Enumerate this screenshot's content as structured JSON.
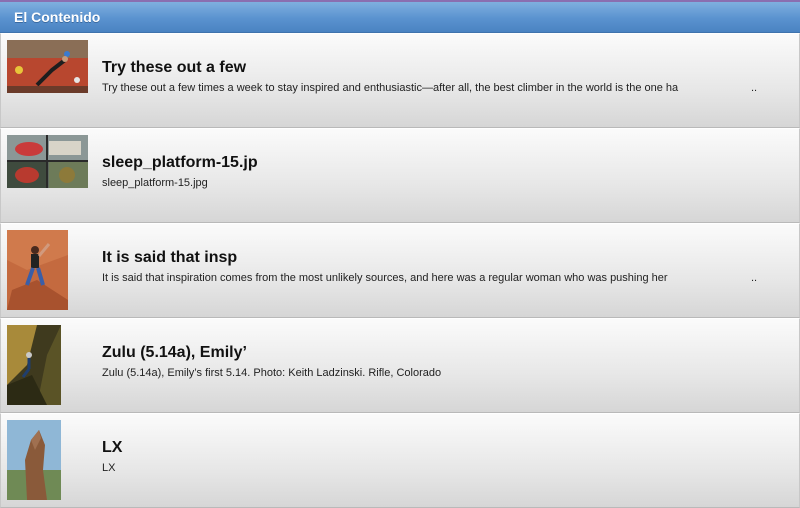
{
  "header": {
    "title": "El Contenido"
  },
  "items": [
    {
      "title": "Try these out a few",
      "desc": "Try these out a few times a week to stay inspired and enthusiastic—after all, the best climber in the world is the one ha",
      "ellipsis": "..",
      "thumb": "climbing-wall-thumbnail"
    },
    {
      "title": "sleep_platform-15.jp",
      "desc": "sleep_platform-15.jpg",
      "ellipsis": "",
      "thumb": "sleep-platform-thumbnail"
    },
    {
      "title": "It is said that insp",
      "desc": "It is said that inspiration comes from the most unlikely sources, and here was a regular woman who was pushing her",
      "ellipsis": "..",
      "thumb": "woman-climbing-thumbnail"
    },
    {
      "title": "Zulu (5.14a), Emily’",
      "desc": "Zulu (5.14a), Emily’s first 5.14. Photo: Keith Ladzinski. Rifle, Colorado",
      "ellipsis": "",
      "thumb": "zulu-climb-thumbnail"
    },
    {
      "title": "LX",
      "desc": "LX",
      "ellipsis": "",
      "thumb": "rock-tower-thumbnail"
    }
  ]
}
